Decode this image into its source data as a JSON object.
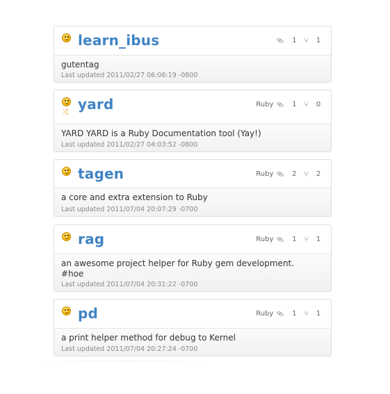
{
  "repos": [
    {
      "name": "learn_ibus",
      "language": "",
      "watchers": "1",
      "forks": "1",
      "description": "gutentag",
      "updated": "Last updated 2011/02/27 06:06:19 -0800",
      "forked": false
    },
    {
      "name": "yard",
      "language": "Ruby",
      "watchers": "1",
      "forks": "0",
      "description": "YARD YARD is a Ruby Documentation tool (Yay!)",
      "updated": "Last updated 2011/02/27 04:03:52 -0800",
      "forked": true
    },
    {
      "name": "tagen",
      "language": "Ruby",
      "watchers": "2",
      "forks": "2",
      "description": "a core and extra extension to Ruby",
      "updated": "Last updated 2011/07/04 20:07:29 -0700",
      "forked": false
    },
    {
      "name": "rag",
      "language": "Ruby",
      "watchers": "1",
      "forks": "1",
      "description": "an awesome project helper for Ruby gem development. #hoe",
      "updated": "Last updated 2011/07/04 20:31:22 -0700",
      "forked": false
    },
    {
      "name": "pd",
      "language": "Ruby",
      "watchers": "1",
      "forks": "1",
      "description": "a print helper method for debug to Kernel",
      "updated": "Last updated 2011/07/04 20:27:24 -0700",
      "forked": false
    }
  ],
  "icons": {
    "status": "smiley-icon",
    "fork": "fork-icon",
    "watchers": "eye-icon",
    "forks": "branch-icon"
  }
}
